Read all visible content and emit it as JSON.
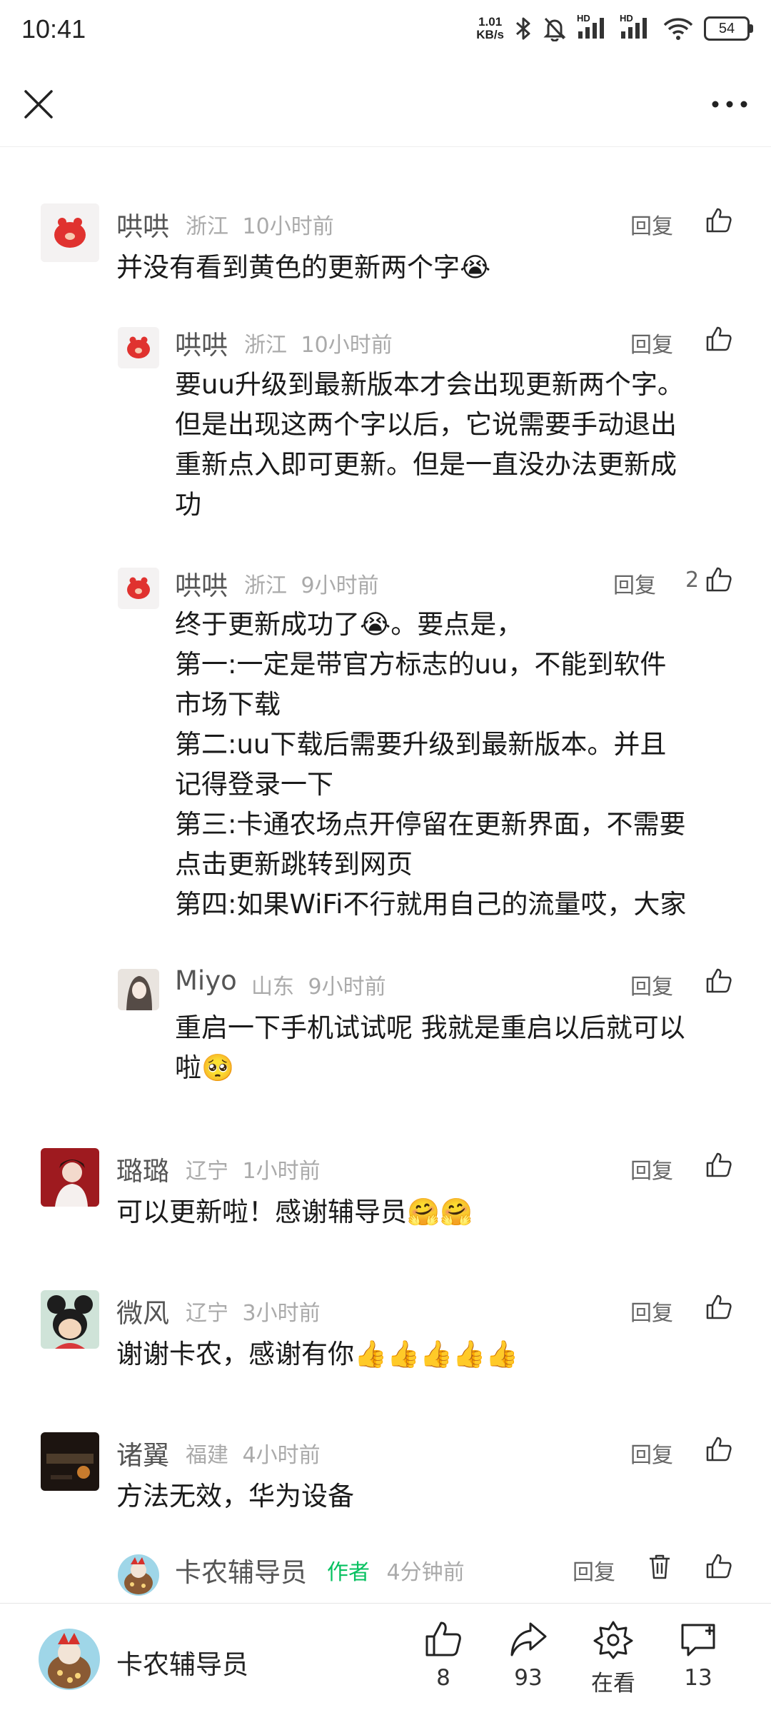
{
  "status_bar": {
    "time": "10:41",
    "net_speed_value": "1.01",
    "net_speed_unit": "KB/s",
    "signal_tag_1": "HD",
    "signal_tag_2": "HD",
    "battery": "54",
    "icons": [
      "bluetooth-icon",
      "mute-bell-icon",
      "signal-icon",
      "signal-icon",
      "wifi-icon",
      "battery-icon"
    ]
  },
  "top_bar": {
    "icons": [
      "close-icon",
      "more-icon"
    ]
  },
  "comments": [
    {
      "name": "哄哄",
      "location": "浙江",
      "time": "10小时前",
      "reply": "回复",
      "text": "并没有看到黄色的更新两个字😭"
    },
    {
      "name": "哄哄",
      "location": "浙江",
      "time": "10小时前",
      "reply": "回复",
      "text_lines": [
        "要uu升级到最新版本才会出现更新两个字。",
        "但是出现这两个字以后，它说需要手动退出",
        "重新点入即可更新。但是一直没办法更新成",
        "功"
      ]
    },
    {
      "name": "哄哄",
      "location": "浙江",
      "time": "9小时前",
      "reply": "回复",
      "likes": "2",
      "text_lines": [
        "终于更新成功了😭。要点是，",
        "第一:一定是带官方标志的uu，不能到软件",
        "市场下载",
        "第二:uu下载后需要升级到最新版本。并且",
        "记得登录一下",
        "第三:卡通农场点开停留在更新界面，不需要",
        "点击更新跳转到网页",
        "第四:如果WiFi不行就用自己的流量哎，大家"
      ]
    },
    {
      "name": "Miyo",
      "location": "山东",
      "time": "9小时前",
      "reply": "回复",
      "text_lines": [
        "重启一下手机试试呢 我就是重启以后就可以",
        "啦🥺"
      ]
    },
    {
      "name": "璐璐",
      "location": "辽宁",
      "time": "1小时前",
      "reply": "回复",
      "text": "可以更新啦！感谢辅导员🤗🤗"
    },
    {
      "name": "微风",
      "location": "辽宁",
      "time": "3小时前",
      "reply": "回复",
      "text": "谢谢卡农，感谢有你👍👍👍👍👍"
    },
    {
      "name": "诸翼",
      "location": "福建",
      "time": "4小时前",
      "reply": "回复",
      "text": "方法无效，华为设备"
    },
    {
      "name": "卡农辅导员",
      "author_tag": "作者",
      "time": "4分钟前",
      "reply": "回复"
    }
  ],
  "bottom_bar": {
    "author_name": "卡农辅导员",
    "like_count": "8",
    "share_count": "93",
    "watching_label": "在看",
    "comment_count": "13"
  },
  "colors": {
    "author_green": "#07c160",
    "meta_gray": "#aaaaaa",
    "name_gray": "#555555"
  }
}
